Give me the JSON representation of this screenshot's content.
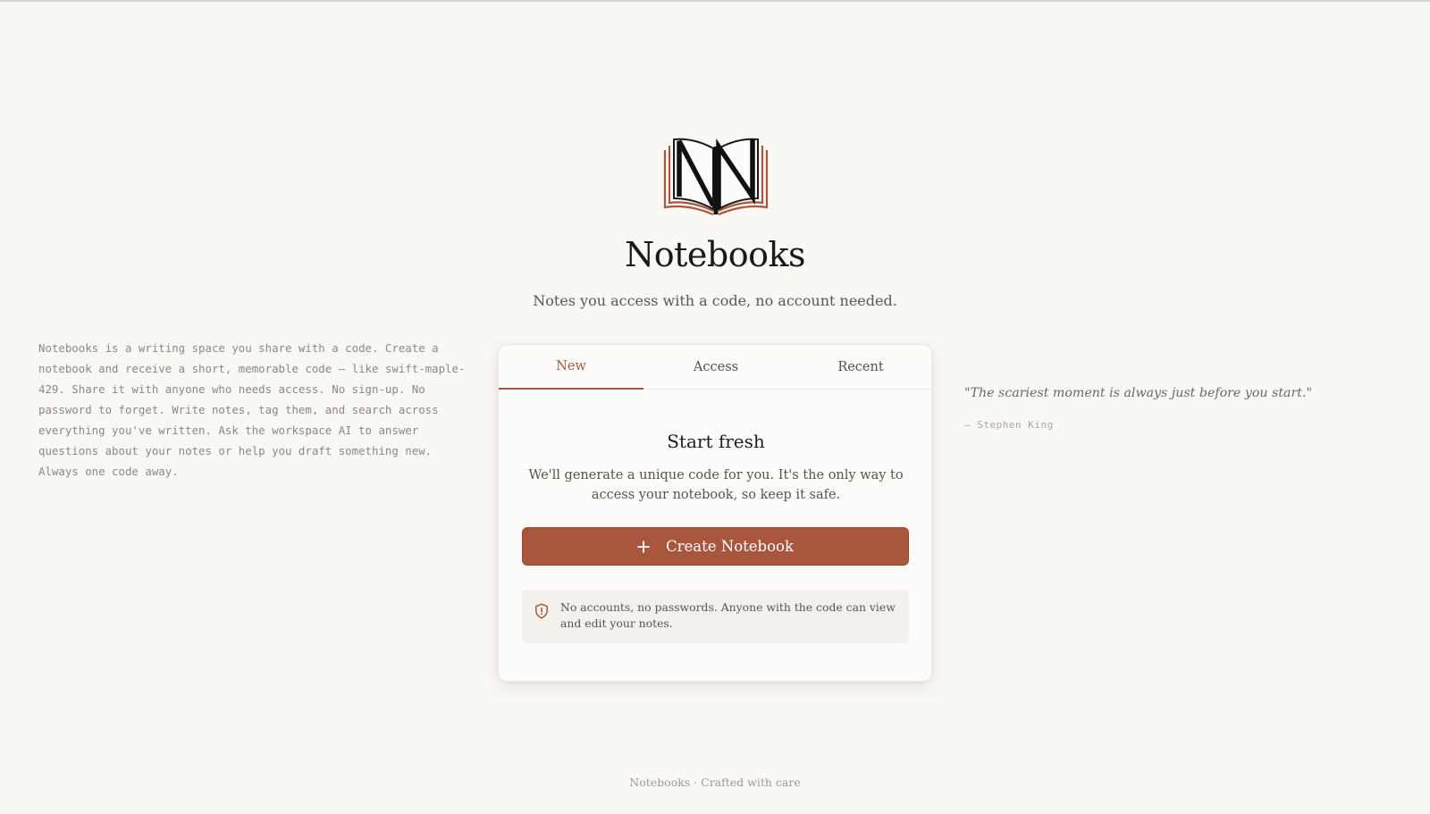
{
  "app": {
    "title": "Notebooks",
    "subtitle": "Notes you access with a code, no account needed.",
    "logo_icon": "open-book-n-logo-icon"
  },
  "intro": {
    "text": "Notebooks is a writing space you share with a code. Create a notebook and receive a short, memorable code — like swift-maple-429. Share it with anyone who needs access. No sign-up. No password to forget. Write notes, tag them, and search across everything you've written. Ask the workspace AI to answer questions about your notes or help you draft something new. Always one code away."
  },
  "quote": {
    "text": "\"The scariest moment is always just before you start.\"",
    "author": "— Stephen King"
  },
  "card": {
    "tabs": [
      {
        "label": "New",
        "active": true
      },
      {
        "label": "Access",
        "active": false
      },
      {
        "label": "Recent",
        "active": false
      }
    ],
    "heading": "Start fresh",
    "description": "We'll generate a unique code for you. It's the only way to access your notebook, so keep it safe.",
    "create_button": {
      "label": "Create Notebook",
      "icon": "plus-icon"
    },
    "notice": {
      "icon": "shield-alert-icon",
      "text": "No accounts, no passwords. Anyone with the code can view and edit your notes."
    }
  },
  "footer": {
    "text": "Notebooks · Crafted with care"
  },
  "colors": {
    "background": "#faf8f4",
    "accent": "#a8573e",
    "text_primary": "#1f1d1a",
    "text_muted": "#8c8882"
  }
}
